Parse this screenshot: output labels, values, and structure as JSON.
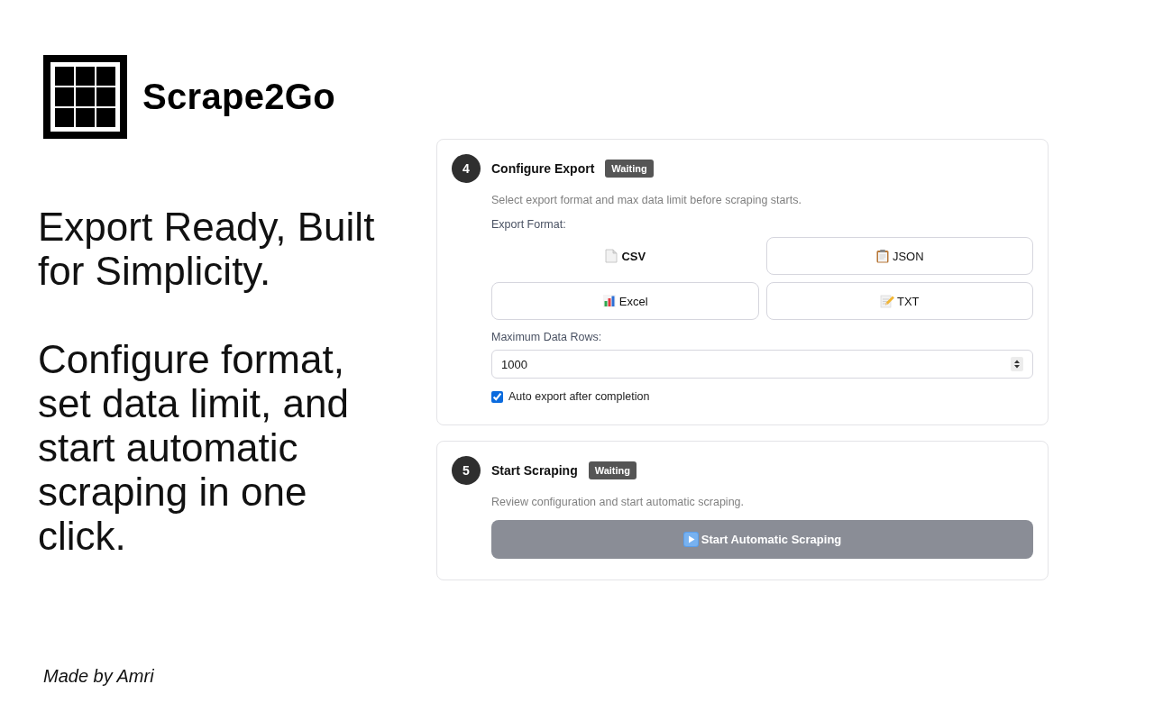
{
  "brand": {
    "name": "Scrape2Go"
  },
  "headline": "Export Ready, Built for Simplicity.",
  "tagline": "Configure format, set data limit, and start automatic scraping in one click.",
  "steps": [
    {
      "kind": "export",
      "number": "4",
      "title": "Configure Export",
      "badge": "Waiting",
      "description": "Select export format and max data limit before scraping starts.",
      "format_label": "Export Format:",
      "formats": [
        {
          "label": "CSV",
          "selected": true
        },
        {
          "label": "JSON",
          "selected": false
        },
        {
          "label": "Excel",
          "selected": false
        },
        {
          "label": "TXT",
          "selected": false
        }
      ],
      "rows_label": "Maximum Data Rows:",
      "rows_value": "1000",
      "auto_export": {
        "label": "Auto export after completion",
        "checked": true
      }
    },
    {
      "kind": "start",
      "number": "5",
      "title": "Start Scraping",
      "badge": "Waiting",
      "description": "Review configuration and start automatic scraping.",
      "button": {
        "label": "Start Automatic Scraping",
        "disabled": true
      }
    }
  ],
  "footer": "Made by Amri"
}
